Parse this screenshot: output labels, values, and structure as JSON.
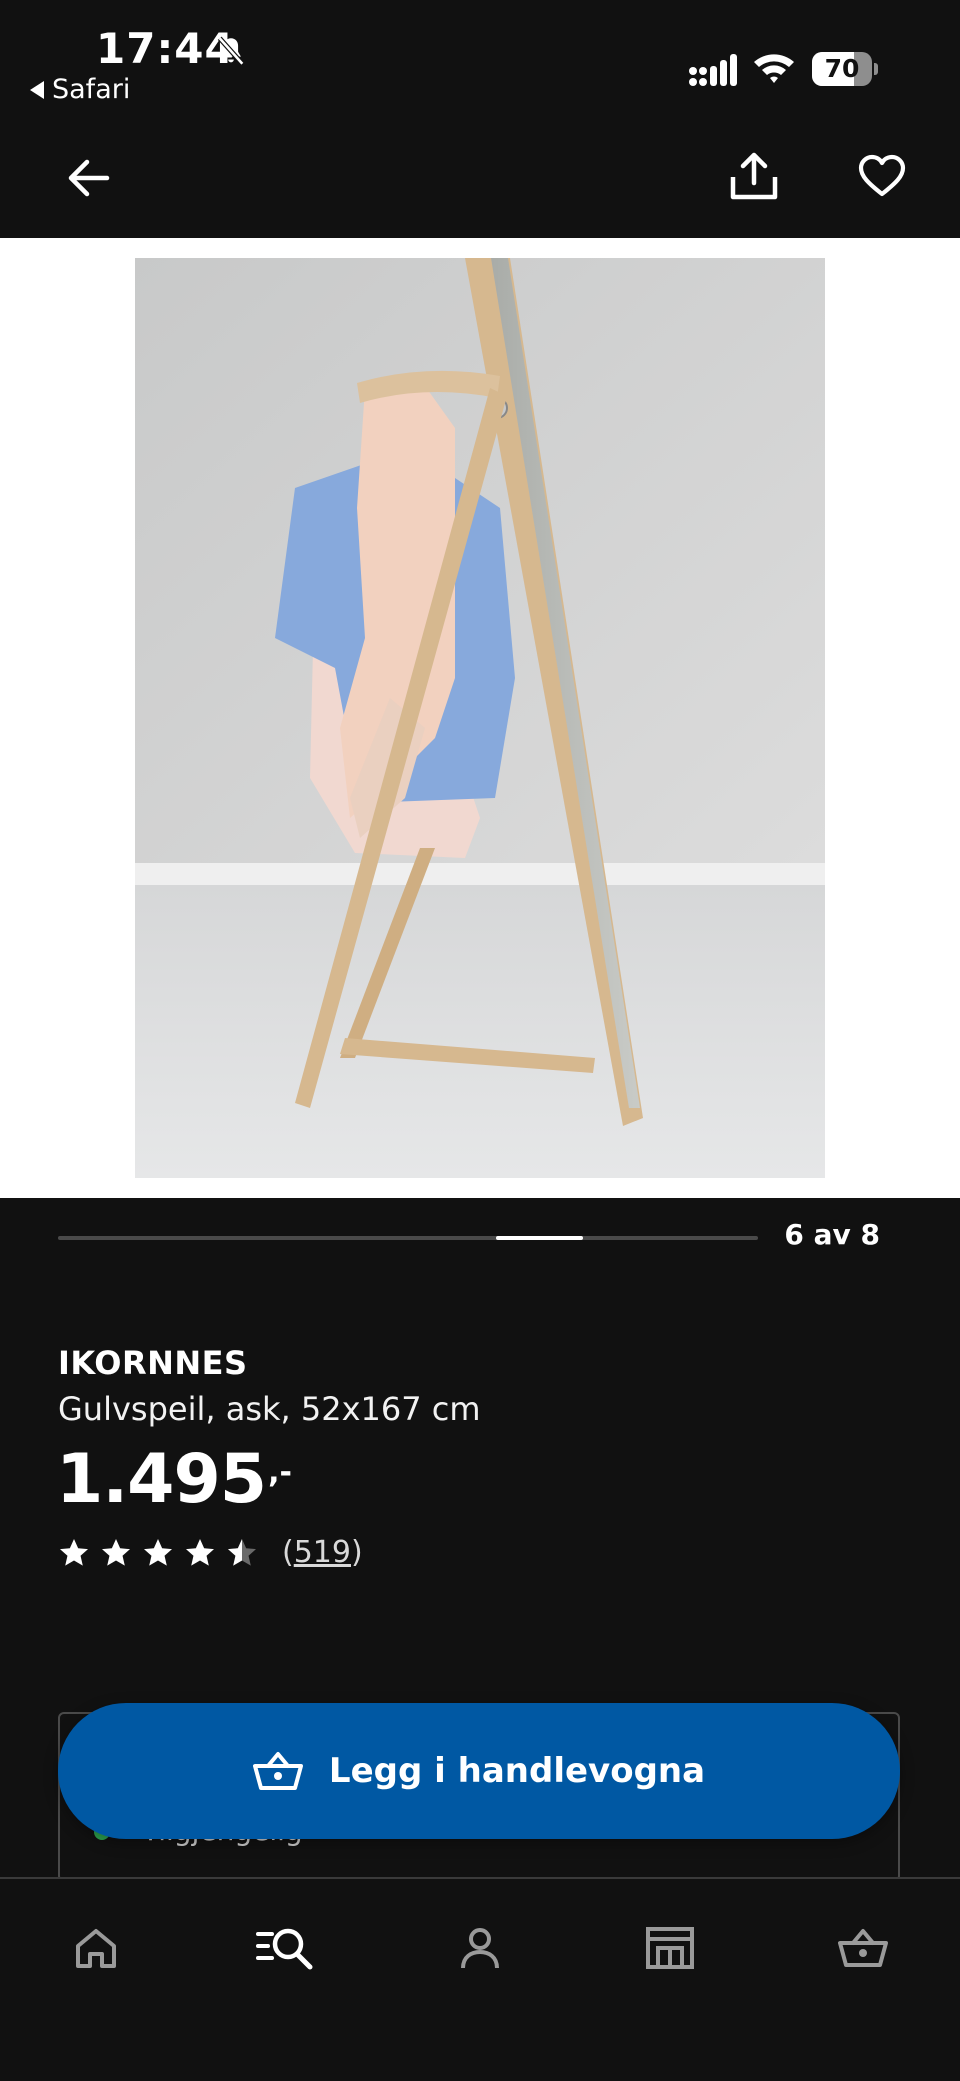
{
  "status_bar": {
    "time": "17:44",
    "back_app_label": "Safari",
    "battery_percent": "70",
    "battery_level": 0.7
  },
  "header": {
    "back_icon": "arrow-left-icon",
    "share_icon": "share-icon",
    "favorite_icon": "heart-outline-icon"
  },
  "carousel": {
    "current": 6,
    "total": 8,
    "counter_text": "6 av 8"
  },
  "product": {
    "name": "IKORNNES",
    "description": "Gulvspeil, ask, 52x167 cm",
    "price": "1.495",
    "price_suffix": ",-",
    "rating": 4.5,
    "rating_max": 5,
    "rating_count_open": "(",
    "rating_count": "519",
    "rating_count_close": ")"
  },
  "availability": {
    "text": "Tilgjengelig"
  },
  "cta": {
    "label": "Legg i handlevogna",
    "icon": "basket-icon"
  },
  "bottom_nav": {
    "items": [
      {
        "icon": "home-icon"
      },
      {
        "icon": "search-icon"
      },
      {
        "icon": "profile-icon"
      },
      {
        "icon": "store-icon"
      },
      {
        "icon": "basket-icon"
      }
    ]
  },
  "colors": {
    "background": "#111111",
    "cta": "#0058a3",
    "available_dot": "#2ea44f"
  }
}
